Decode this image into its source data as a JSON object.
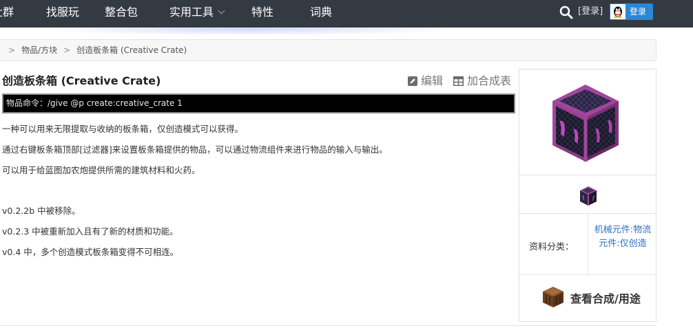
{
  "nav": {
    "items": [
      "社群",
      "找服玩",
      "整合包",
      "实用工具",
      "特性",
      "词典"
    ],
    "login_link": "[登录]",
    "qq_login": "登录"
  },
  "breadcrumb": {
    "sep": ">",
    "items": [
      "物品/方块",
      "创造板条箱 (Creative Crate)"
    ]
  },
  "article": {
    "title": "创造板条箱 (Creative Crate)",
    "edit_label": "编辑",
    "add_table_label": "加合成表",
    "command": "物品命令：/give @p create:creative_crate 1",
    "paragraphs": [
      "一种可以用来无限提取与收纳的板条箱，仅创造模式可以获得。",
      "通过右键板条箱顶部[过滤器]来设置板条箱提供的物品，可以通过物流组件来进行物品的输入与输出。",
      "可以用于给蓝图加农炮提供所需的建筑材料和火药。",
      "v0.2.2b 中被移除。",
      "v0.2.3 中被重新加入且有了新的材质和功能。",
      "v0.4 中，多个创造模式板条箱变得不可相连。"
    ]
  },
  "infobox": {
    "category_label": "资料分类：",
    "category_value": "机械元件:物流元件:仅创造",
    "recipe_label": "查看合成/用途"
  },
  "colors": {
    "nav_bg": "#333a42",
    "link": "#2a6fc4",
    "qq_button": "#2a86d6",
    "crate_purple": "#a2469c"
  }
}
